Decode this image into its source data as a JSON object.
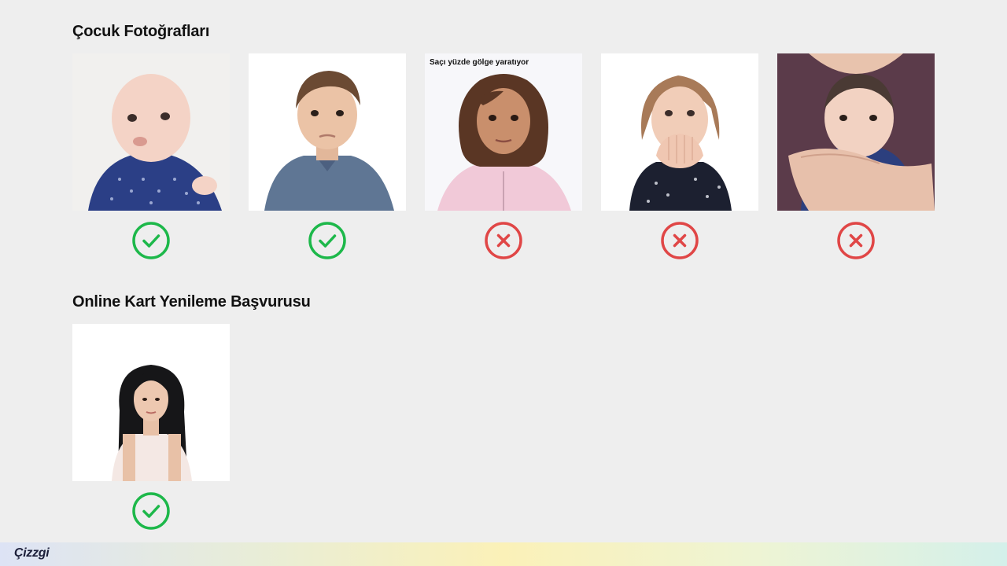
{
  "sections": [
    {
      "title": "Çocuk Fotoğrafları",
      "photos": [
        {
          "subject": "baby-lying",
          "status": "valid",
          "status_icon": "check-circle-icon"
        },
        {
          "subject": "toddler-boy",
          "status": "valid",
          "status_icon": "check-circle-icon"
        },
        {
          "subject": "girl-curly-hair",
          "caption": "Saçı yüzde gölge yaratıyor",
          "status": "invalid",
          "status_icon": "x-circle-icon"
        },
        {
          "subject": "girl-hands-over-mouth",
          "status": "invalid",
          "status_icon": "x-circle-icon"
        },
        {
          "subject": "baby-held-by-adult",
          "status": "invalid",
          "status_icon": "x-circle-icon"
        }
      ]
    },
    {
      "title": "Online Kart Yenileme Başvurusu",
      "photos": [
        {
          "subject": "adult-woman",
          "status": "valid",
          "status_icon": "check-circle-icon"
        }
      ]
    }
  ],
  "footer": {
    "logo": "Çizzgi"
  },
  "colors": {
    "background": "#eeeeee",
    "valid": "#1db84a",
    "invalid": "#e04646",
    "logo": "#1c1f3a"
  }
}
